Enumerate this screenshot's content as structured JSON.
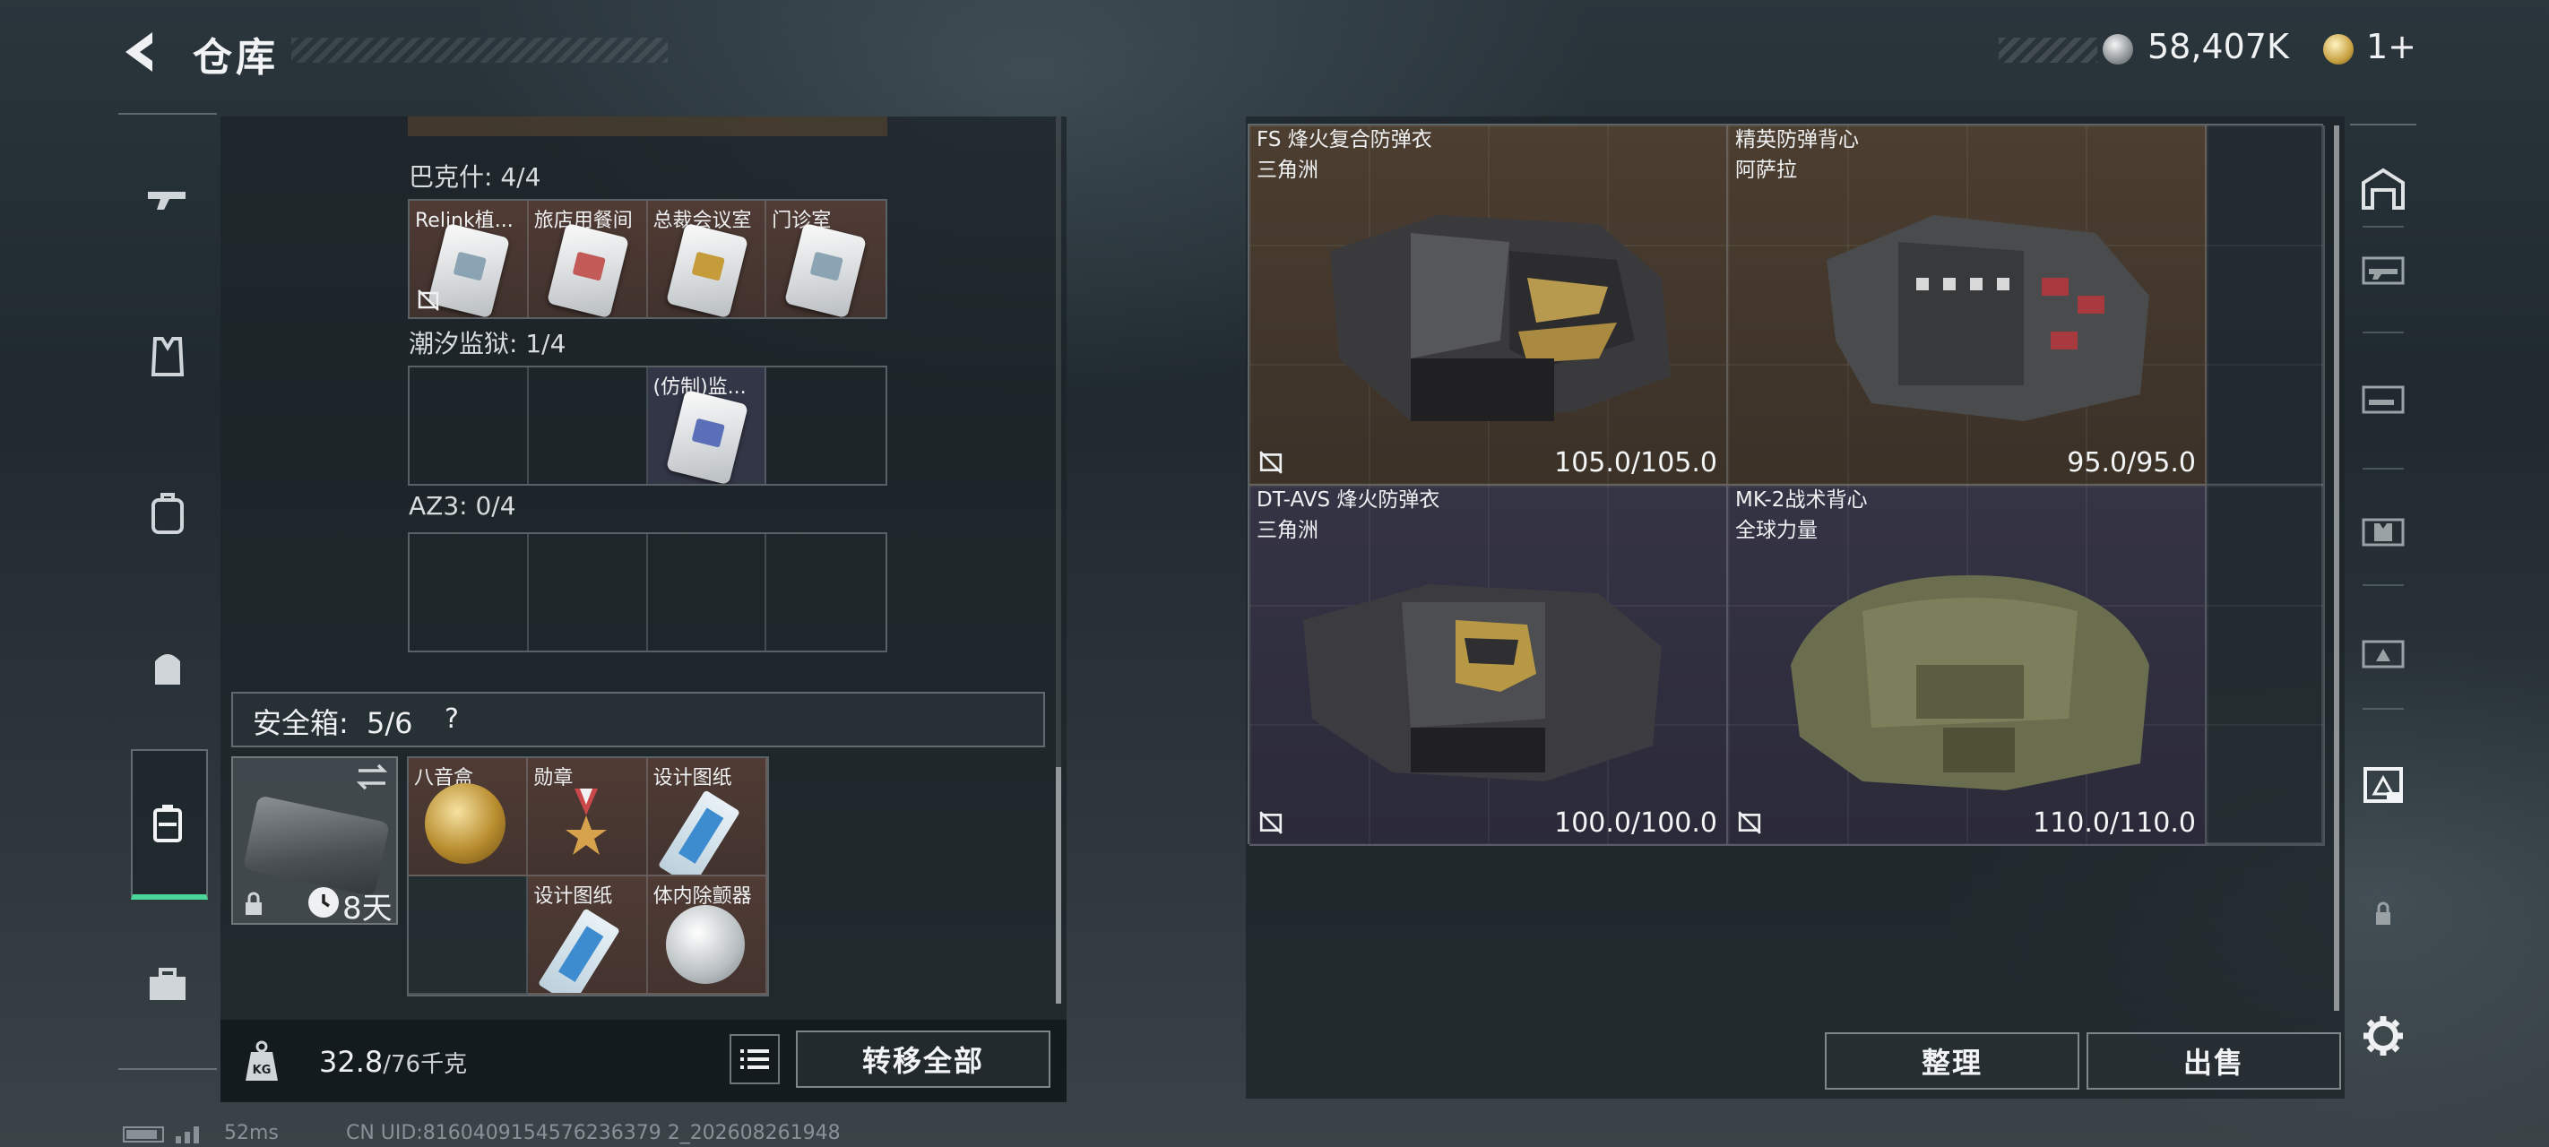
{
  "header": {
    "title": "仓库"
  },
  "currency": {
    "silver": "58,407K",
    "gold": "1+"
  },
  "storage_groups": [
    {
      "label": "巴克什: 4/4",
      "items": [
        {
          "label": "Relink植...",
          "card": "silver",
          "locked": true
        },
        {
          "label": "旅店用餐间",
          "card": "red",
          "locked": false
        },
        {
          "label": "总裁会议室",
          "card": "gold",
          "locked": false
        },
        {
          "label": "门诊室",
          "card": "silver",
          "locked": false
        }
      ]
    },
    {
      "label": "潮汐监狱: 1/4",
      "items": [
        null,
        null,
        {
          "label": "(仿制)监...",
          "card": "blue",
          "locked": false
        },
        null
      ]
    },
    {
      "label": "AZ3: 0/4",
      "items": [
        null,
        null,
        null,
        null
      ]
    }
  ],
  "safe_box": {
    "label": "安全箱:",
    "count": "5/6",
    "help": "?",
    "days": "8天",
    "items": [
      {
        "label": "八音盒",
        "kind": "gold-disc"
      },
      {
        "label": "勋章",
        "kind": "medal"
      },
      {
        "label": "设计图纸",
        "kind": "blueprint"
      },
      null,
      {
        "label": "设计图纸",
        "kind": "blueprint"
      },
      {
        "label": "体内除颤器",
        "kind": "silver-disc"
      }
    ]
  },
  "weight": {
    "current": "32.8",
    "capacity": "/76千克"
  },
  "buttons": {
    "transfer_all": "转移全部",
    "organize": "整理",
    "sell": "出售"
  },
  "armor": [
    {
      "name": "FS 烽火复合防弹衣",
      "maker": "三角洲",
      "durability": "105.0/105.0",
      "bg": "brown"
    },
    {
      "name": "精英防弹背心",
      "maker": "阿萨拉",
      "durability": "95.0/95.0",
      "bg": "brown"
    },
    {
      "name": "DT-AVS 烽火防弹衣",
      "maker": "三角洲",
      "durability": "100.0/100.0",
      "bg": "purple"
    },
    {
      "name": "MK-2战术背心",
      "maker": "全球力量",
      "durability": "110.0/110.0",
      "bg": "purple"
    }
  ],
  "status": {
    "ping": "52ms",
    "uid": "CN UID:8160409154576236379 2_202608261948"
  },
  "colors": {
    "accent_green": "#4bd79a",
    "brown_cell": "#4c3e30",
    "purple_cell": "#353445"
  }
}
